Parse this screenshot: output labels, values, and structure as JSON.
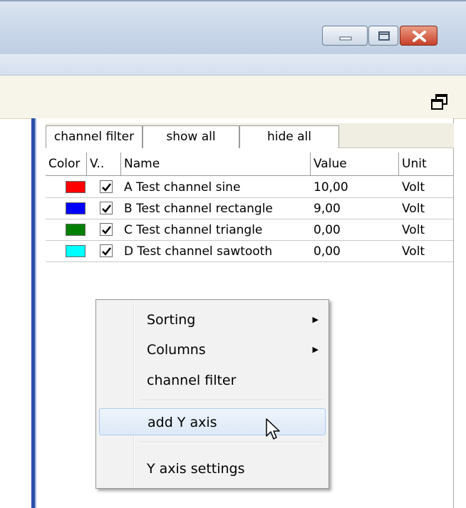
{
  "window": {
    "controls": [
      "minimize-icon",
      "maximize-icon",
      "close-icon"
    ],
    "close_color": "#c8412a"
  },
  "filter_bar": {
    "buttons": [
      "channel filter",
      "show all",
      "hide all"
    ]
  },
  "table": {
    "headers": {
      "color": "Color",
      "visible": "V..",
      "name": "Name",
      "value": "Value",
      "unit": "Unit"
    },
    "rows": [
      {
        "color": "#ff0000",
        "checked": true,
        "name": "A Test channel sine",
        "value": "10,00",
        "unit": "Volt"
      },
      {
        "color": "#0000ff",
        "checked": true,
        "name": "B Test channel rectangle",
        "value": "9,00",
        "unit": "Volt"
      },
      {
        "color": "#007f00",
        "checked": true,
        "name": "C Test channel triangle",
        "value": "0,00",
        "unit": "Volt"
      },
      {
        "color": "#00ffff",
        "checked": true,
        "name": "D Test channel sawtooth",
        "value": "0,00",
        "unit": "Volt"
      }
    ]
  },
  "context_menu": {
    "items": [
      {
        "label": "Sorting",
        "submenu": true
      },
      {
        "label": "Columns",
        "submenu": true
      },
      {
        "label": "channel filter",
        "submenu": false
      },
      {
        "label": "add Y axis",
        "submenu": false,
        "highlighted": true
      },
      {
        "label": "Y axis settings",
        "submenu": false
      }
    ]
  }
}
